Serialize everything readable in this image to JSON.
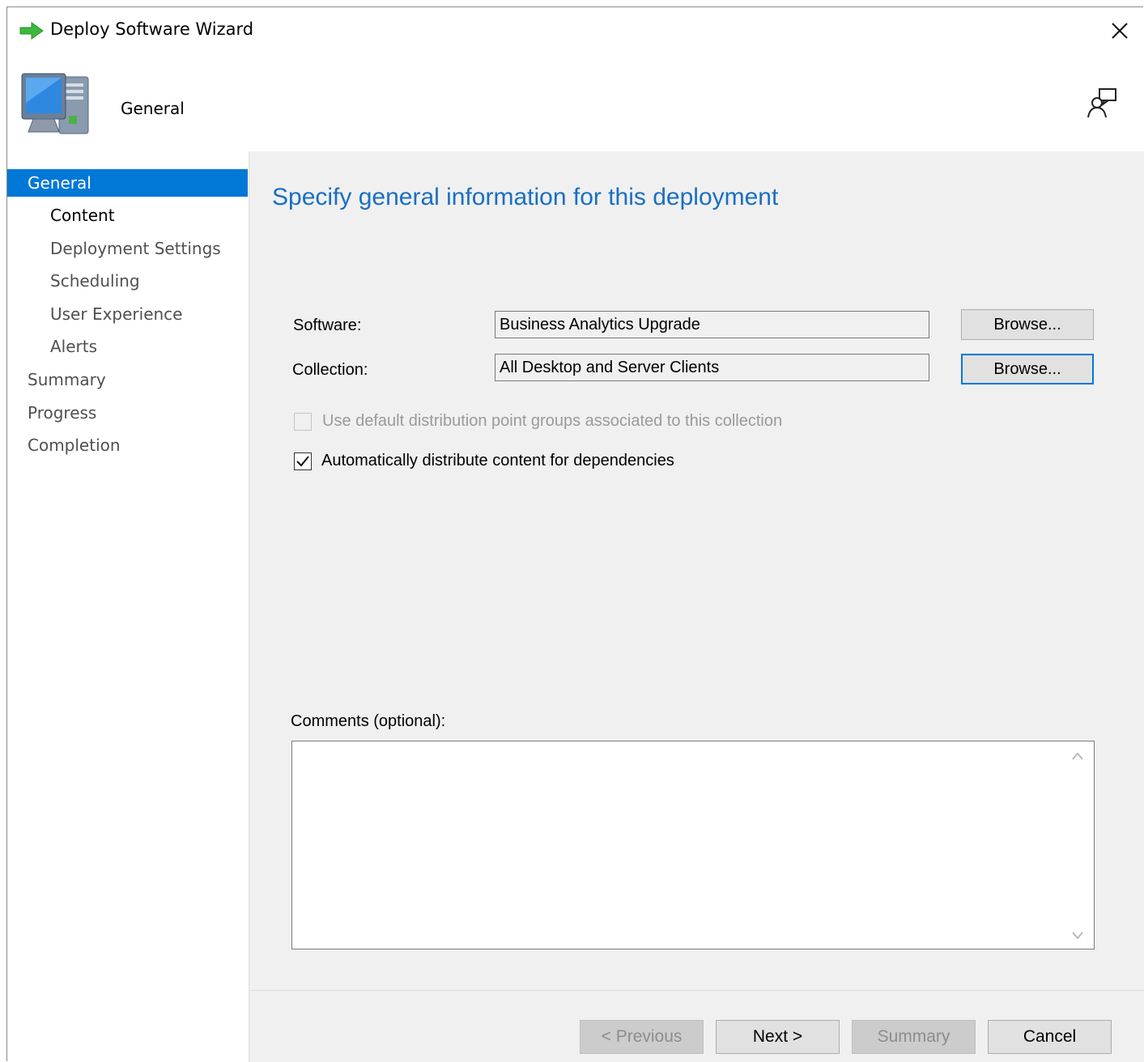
{
  "window": {
    "title": "Deploy Software Wizard"
  },
  "header": {
    "title": "General"
  },
  "sidebar": {
    "items": [
      {
        "label": "General"
      },
      {
        "label": "Content"
      },
      {
        "label": "Deployment Settings"
      },
      {
        "label": "Scheduling"
      },
      {
        "label": "User Experience"
      },
      {
        "label": "Alerts"
      },
      {
        "label": "Summary"
      },
      {
        "label": "Progress"
      },
      {
        "label": "Completion"
      }
    ]
  },
  "main": {
    "heading": "Specify general information for this deployment",
    "software": {
      "label": "Software:",
      "value": "Business Analytics Upgrade",
      "browse_label": "Browse..."
    },
    "collection": {
      "label": "Collection:",
      "value": "All Desktop and Server Clients",
      "browse_label": "Browse..."
    },
    "use_default_dp": {
      "label": "Use default distribution point groups associated to this collection",
      "checked": false,
      "enabled": false
    },
    "auto_distribute": {
      "label": "Automatically distribute content for dependencies",
      "checked": true,
      "enabled": true
    },
    "comments": {
      "label": "Comments (optional):",
      "value": ""
    }
  },
  "footer": {
    "previous_label": "< Previous",
    "next_label": "Next >",
    "summary_label": "Summary",
    "cancel_label": "Cancel"
  },
  "colors": {
    "accent": "#0078d7",
    "heading": "#1a6fc2",
    "panel_bg": "#f0f0f0"
  }
}
